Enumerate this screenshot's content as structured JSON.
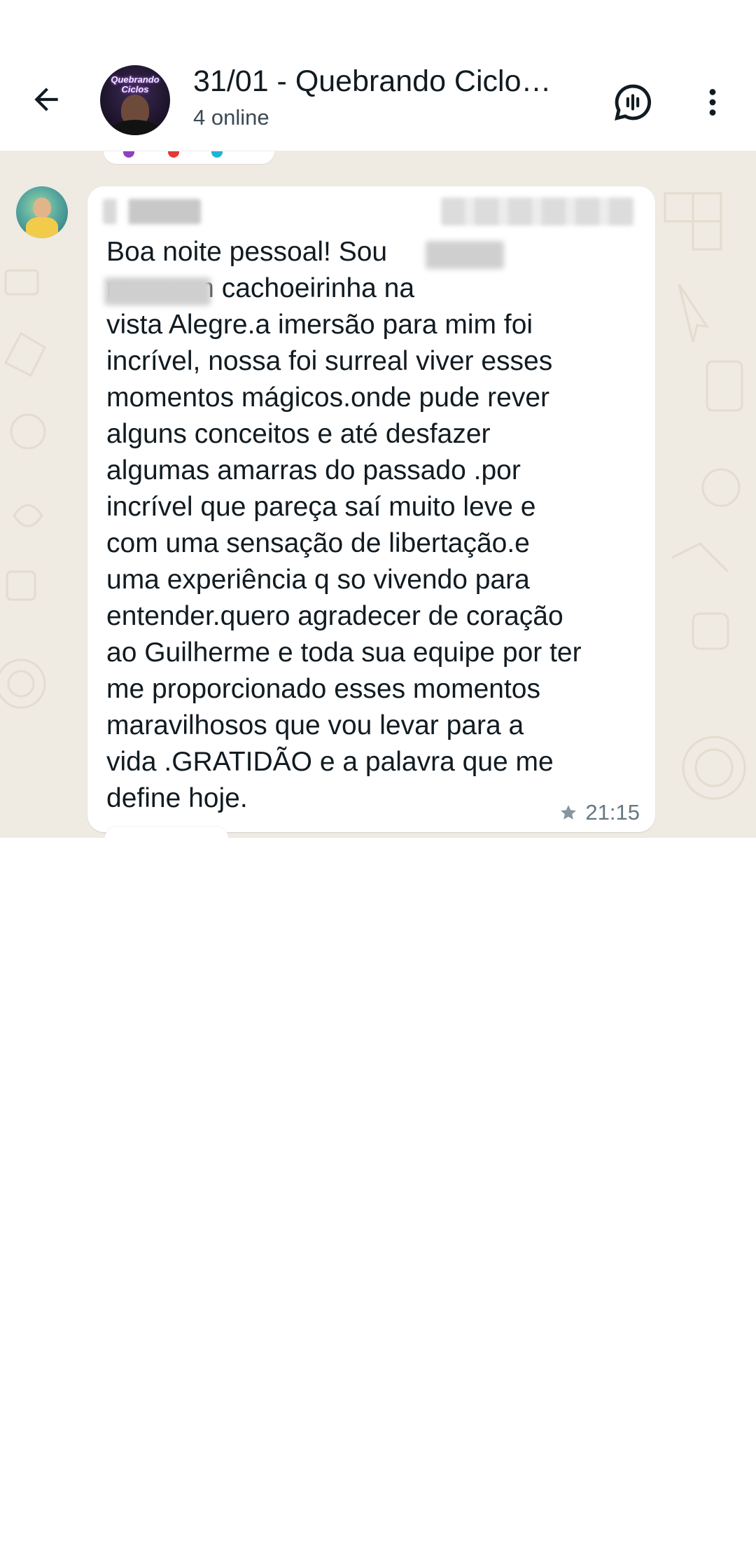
{
  "header": {
    "back_icon": "arrow-left-icon",
    "group_name": "31/01 - Quebrando Ciclo…",
    "status": "4 online",
    "avatar_logo": "Quebrando Ciclos",
    "call_icon": "voice-chat-icon",
    "menu_icon": "more-vert-icon"
  },
  "message": {
    "sender_name": "",
    "sender_phone": "",
    "text": "Boa noite pessoal! Sou           \n             moro em cachoeirinha na\nvista Alegre.a imersão para mim foi\nincrível, nossa foi surreal viver esses\nmomentos mágicos.onde pude rever\nalguns conceitos e até desfazer\nalgumas amarras do passado .por\nincrível que pareça saí muito leve e\ncom uma sensação de libertação.e\numa experiência q so vivendo para\nentender.quero agradecer de coração\nao Guilherme e toda sua equipe por ter\nme proporcionado esses momentos\nmaravilhosos que vou levar para a\nvida .GRATIDÃO e a palavra que me\ndefine hoje.",
    "starred_icon": "star-icon",
    "time": "21:15"
  },
  "colors": {
    "chat_background": "#efeae2",
    "bubble": "#ffffff",
    "meta_text": "#667781",
    "reaction_purple": "#8e3fc3",
    "reaction_red": "#e53935",
    "reaction_cyan": "#1fb6d0"
  }
}
